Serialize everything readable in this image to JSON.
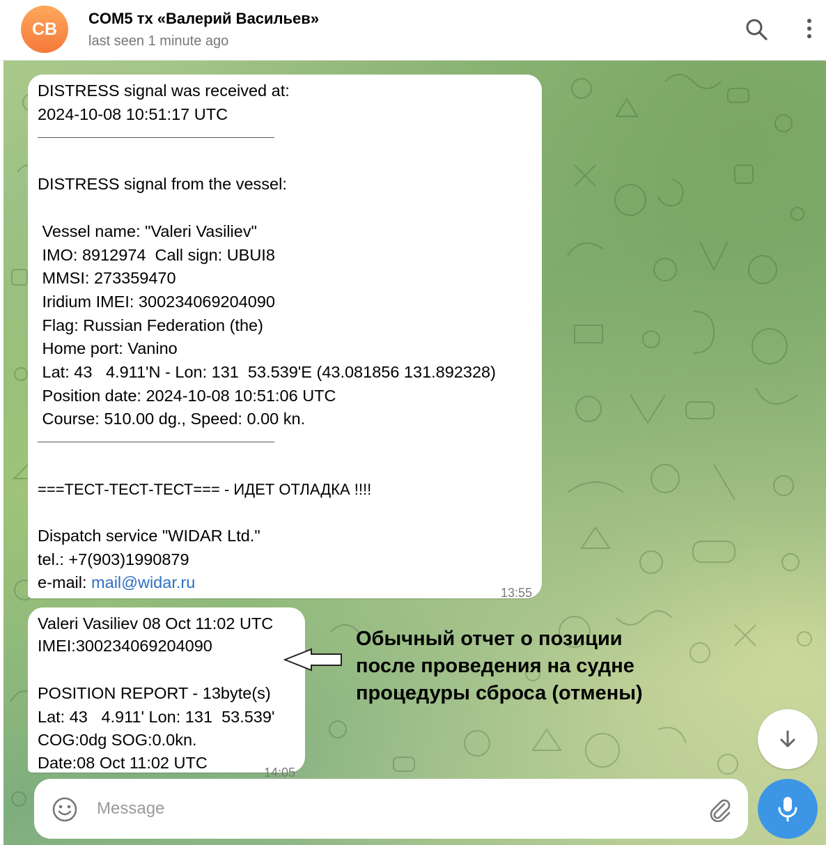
{
  "header": {
    "avatar_initials": "СВ",
    "title": "COM5 тх «Валерий Васильев»",
    "status": "last seen 1 minute ago",
    "search_icon": "search-icon",
    "menu_icon": "more-vertical-icon"
  },
  "messages": [
    {
      "lines": [
        "DISTRESS signal was received at:",
        "2024-10-08 10:51:17 UTC",
        "DISTRESS signal from the vessel:",
        " Vessel name: \"Valeri Vasiliev\"",
        " IMO: 8912974  Call sign: UBUI8",
        " MMSI: 273359470",
        " Iridium IMEI: 300234069204090",
        " Flag: Russian Federation (the)",
        " Home port: Vanino",
        " Lat: 43   4.911'N - Lon: 131  53.539'E (43.081856 131.892328)",
        " Position date: 2024-10-08 10:51:06 UTC",
        " Course: 510.00 dg., Speed: 0.00 kn.",
        "===ТЕСТ-ТЕСТ-ТЕСТ=== - ИДЕТ ОТЛАДКА !!!!",
        "Dispatch service \"WIDAR Ltd.\"",
        "tel.: +7(903)1990879",
        "e-mail: "
      ],
      "email": "mail@widar.ru",
      "time": "13:55"
    },
    {
      "lines": [
        "Valeri Vasiliev 08 Oct 11:02 UTC",
        "IMEI:300234069204090",
        "POSITION REPORT - 13byte(s)",
        "Lat: 43   4.911' Lon: 131  53.539'",
        "COG:0dg SOG:0.0kn.",
        "Date:08 Oct 11:02 UTC"
      ],
      "time": "14:05"
    }
  ],
  "annotation": {
    "lines": [
      "Обычный отчет о позиции",
      "после проведения на судне",
      "процедуры сброса (отмены)"
    ]
  },
  "composer": {
    "placeholder": "Message",
    "emoji_icon": "emoji-icon",
    "attach_icon": "paperclip-icon",
    "mic_icon": "microphone-icon",
    "scroll_icon": "arrow-down-icon"
  },
  "colors": {
    "accent": "#3d95e6",
    "avatar": "#f5793a",
    "link": "#2f6fc1"
  }
}
